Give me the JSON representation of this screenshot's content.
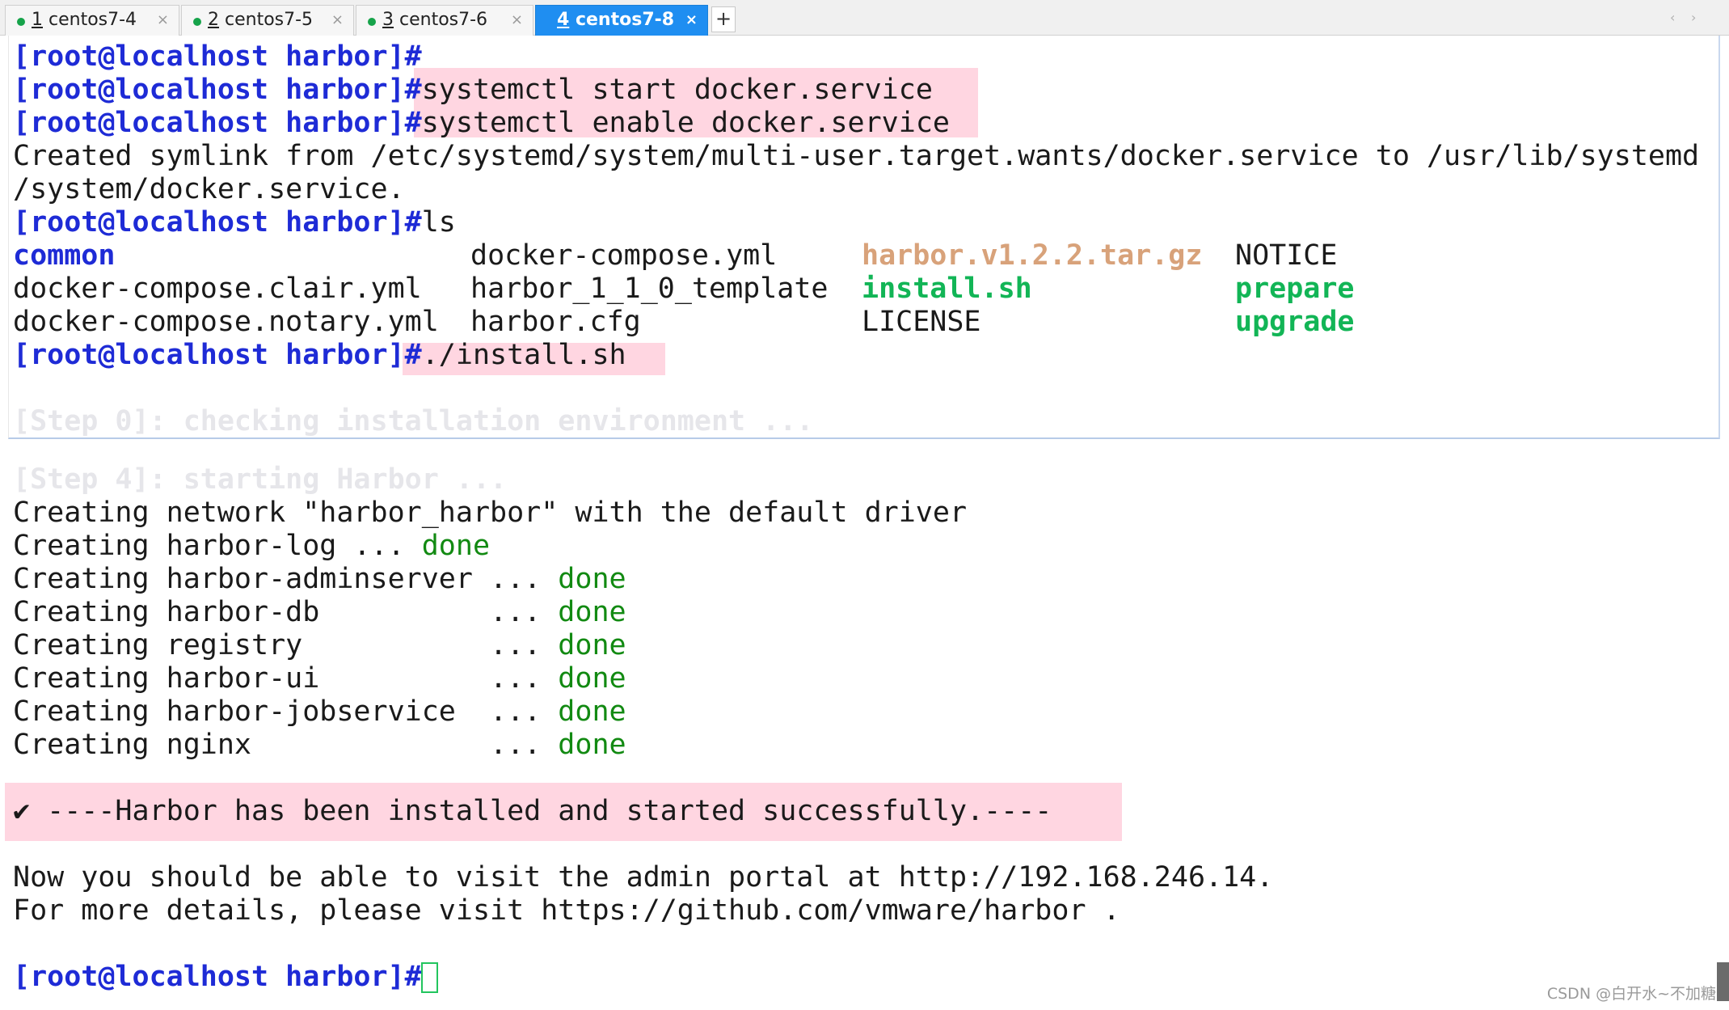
{
  "tabs": [
    {
      "num": "1",
      "name": " centos7-4",
      "active": false
    },
    {
      "num": "2",
      "name": " centos7-5",
      "active": false
    },
    {
      "num": "3",
      "name": " centos7-6",
      "active": false
    },
    {
      "num": "4",
      "name": " centos7-8",
      "active": true
    }
  ],
  "tab_close_glyph": "×",
  "tab_add_glyph": "+",
  "tab_scroll": {
    "left": "‹",
    "right": "›"
  },
  "colors": {
    "prompt": "#1e2bd6",
    "executable": "#12b556",
    "archive": "#d8a27a",
    "done": "#128a12",
    "highlight": "#ffd6e1",
    "active_tab": "#1f8ef1"
  },
  "terminal": {
    "prompt": "[root@localhost harbor]#",
    "cmd1": "systemctl start docker.service",
    "cmd2": "systemctl enable docker.service",
    "symlink_line1": "Created symlink from /etc/systemd/system/multi-user.target.wants/docker.service to /usr/lib/systemd",
    "symlink_line2": "/system/docker.service.",
    "cmd3": "ls",
    "ls": {
      "r1": [
        "common",
        "docker-compose.yml",
        "harbor.v1.2.2.tar.gz",
        "NOTICE"
      ],
      "r2": [
        "docker-compose.clair.yml",
        "harbor_1_1_0_template",
        "install.sh",
        "prepare"
      ],
      "r3": [
        "docker-compose.notary.yml",
        "harbor.cfg",
        "LICENSE",
        "upgrade"
      ]
    },
    "cmd4": "./install.sh",
    "faded_step0": "[Step 0]: checking installation environment ...",
    "faded_step4": "[Step 4]: starting Harbor ...",
    "network_line": "Creating network \"harbor_harbor\" with the default driver",
    "creating": [
      {
        "text": "Creating harbor-log ... ",
        "status": "done"
      },
      {
        "text": "Creating harbor-adminserver ... ",
        "status": "done"
      },
      {
        "text": "Creating harbor-db          ... ",
        "status": "done"
      },
      {
        "text": "Creating registry           ... ",
        "status": "done"
      },
      {
        "text": "Creating harbor-ui          ... ",
        "status": "done"
      },
      {
        "text": "Creating harbor-jobservice  ... ",
        "status": "done"
      },
      {
        "text": "Creating nginx              ... ",
        "status": "done"
      }
    ],
    "success": "✔ ----Harbor has been installed and started successfully.----",
    "portal_line": "Now you should be able to visit the admin portal at http://192.168.246.14.",
    "details_line": "For more details, please visit https://github.com/vmware/harbor ."
  },
  "watermark": "CSDN @白开水~不加糖"
}
